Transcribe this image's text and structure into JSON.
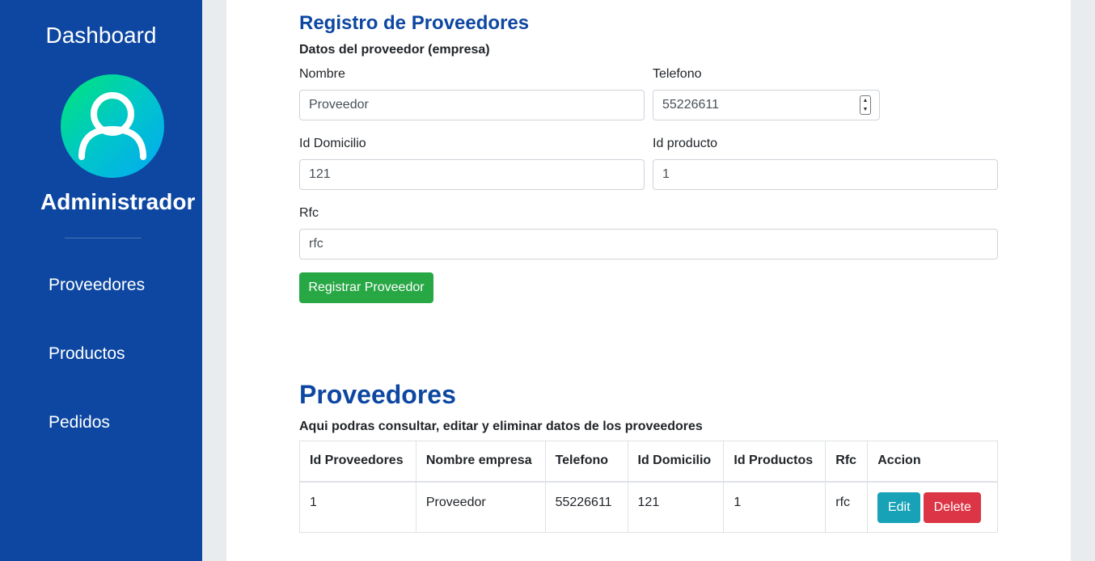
{
  "sidebar": {
    "title": "Dashboard",
    "avatar_icon": "user-icon",
    "role": "Administrador",
    "items": [
      {
        "label": "Proveedores"
      },
      {
        "label": "Productos"
      },
      {
        "label": "Pedidos"
      }
    ]
  },
  "form": {
    "title": "Registro de Proveedores",
    "subtitle": "Datos del proveedor (empresa)",
    "fields": {
      "nombre": {
        "label": "Nombre",
        "value": "Proveedor"
      },
      "telefono": {
        "label": "Telefono",
        "value": "55226611"
      },
      "domicilio": {
        "label": "Id Domicilio",
        "value": "121"
      },
      "producto": {
        "label": "Id producto",
        "value": "1"
      },
      "rfc": {
        "label": "Rfc",
        "value": "rfc"
      }
    },
    "submit_label": "Registrar Proveedor"
  },
  "list": {
    "title": "Proveedores",
    "subtitle": "Aqui podras consultar, editar y eliminar datos de los proveedores",
    "columns": [
      "Id Proveedores",
      "Nombre empresa",
      "Telefono",
      "Id Domicilio",
      "Id Productos",
      "Rfc",
      "Accion"
    ],
    "rows": [
      {
        "id": "1",
        "nombre": "Proveedor",
        "telefono": "55226611",
        "domicilio": "121",
        "productos": "1",
        "rfc": "rfc",
        "edit_label": "Edit",
        "delete_label": "Delete"
      }
    ]
  },
  "colors": {
    "primary": "#0d47a1",
    "success": "#28a745",
    "info": "#17a2b8",
    "danger": "#dc3545"
  }
}
